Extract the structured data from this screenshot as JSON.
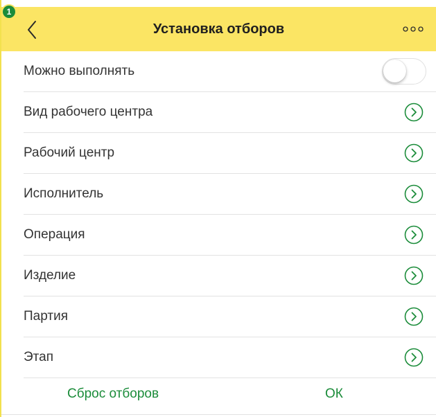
{
  "header": {
    "badge": "1",
    "title": "Установка отборов",
    "back_icon": "chevron-left-icon",
    "more_icon": "more-dots-icon"
  },
  "toggle_row": {
    "label": "Можно выполнять",
    "enabled": false
  },
  "rows": [
    {
      "label": "Вид рабочего центра"
    },
    {
      "label": "Рабочий центр"
    },
    {
      "label": "Исполнитель"
    },
    {
      "label": "Операция"
    },
    {
      "label": "Изделие"
    },
    {
      "label": "Партия"
    },
    {
      "label": "Этап"
    }
  ],
  "footer": {
    "reset_label": "Сброс отборов",
    "ok_label": "ОК"
  },
  "colors": {
    "header_bg": "#fbe564",
    "accent_green": "#1b8c3a"
  }
}
